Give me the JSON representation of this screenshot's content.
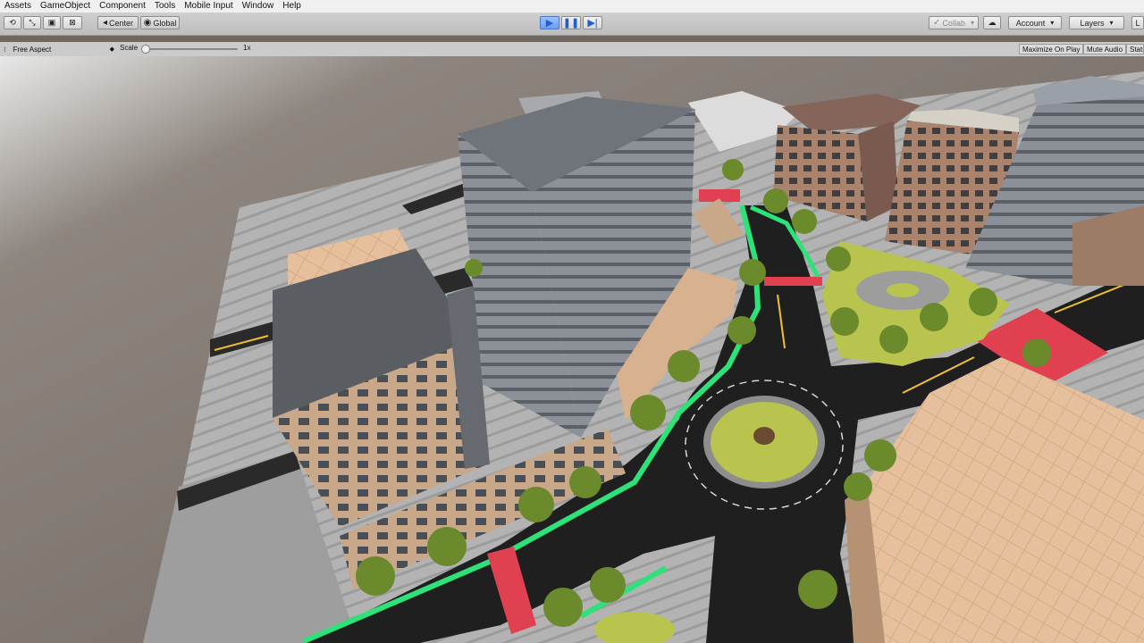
{
  "menu": [
    "Assets",
    "GameObject",
    "Component",
    "Tools",
    "Mobile Input",
    "Window",
    "Help"
  ],
  "toolbar": {
    "transform_tools": [
      "refresh-icon",
      "rect-icon",
      "scale-icon",
      "transform-icon"
    ],
    "pivot_center": "Center",
    "pivot_global": "Global",
    "collab": "Collab",
    "account": "Account",
    "layers": "Layers",
    "layout": "L",
    "play_state": "playing"
  },
  "game_view": {
    "aspect": "Free Aspect",
    "scale_label": "Scale",
    "scale_value": "1x",
    "maximize_on_play": "Maximize On Play",
    "mute_audio": "Mute Audio",
    "stats": "Stats"
  },
  "colors": {
    "menubar": "#f0f0f0",
    "toolbar": "#c6c6c6",
    "background": "#6f6760",
    "road": "#1f1f20",
    "grass": "#b9c44e",
    "bike_lane": "#2ee27a",
    "crossing": "#e0404f"
  }
}
